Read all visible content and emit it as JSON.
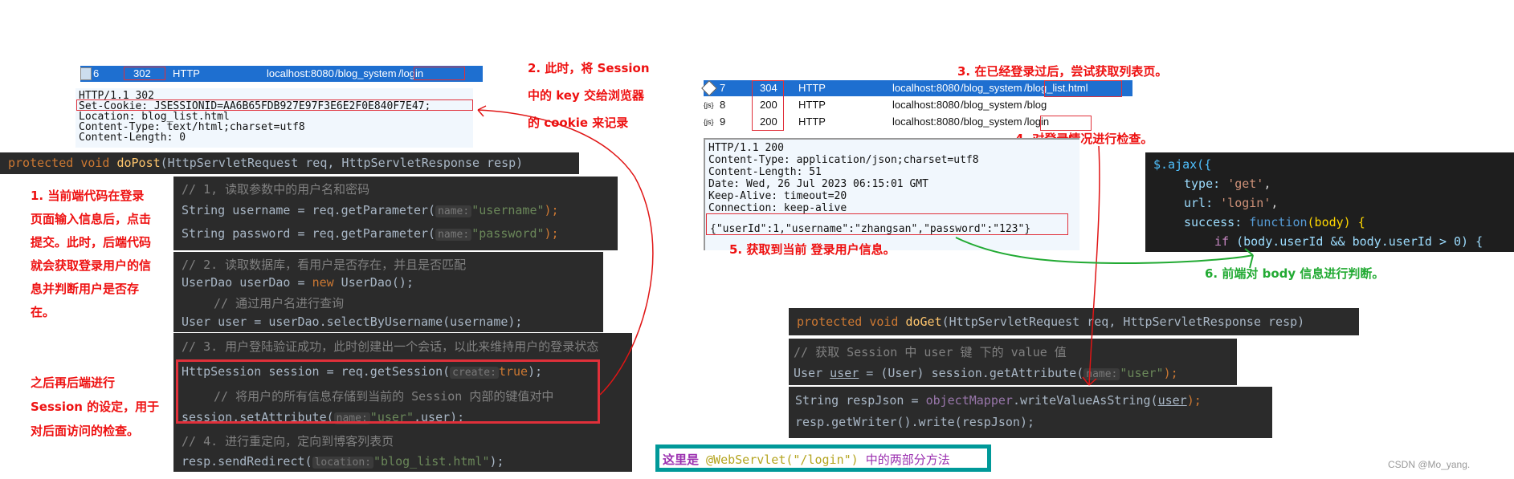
{
  "left_network": {
    "row": {
      "id": "6",
      "status": "302",
      "proto": "HTTP",
      "host": "localhost:8080",
      "path_prefix": "/blog_system",
      "path": "/login"
    }
  },
  "left_response": {
    "lines": [
      "HTTP/1.1 302",
      "Set-Cookie: JSESSIONID=AA6B65FDB927E97F3E6E2F0E840F7E47;",
      "Location: blog_list.html",
      "Content-Type: text/html;charset=utf8",
      "Content-Length: 0"
    ]
  },
  "right_network": {
    "rows": [
      {
        "id": "7",
        "status": "304",
        "proto": "HTTP",
        "host": "localhost:8080",
        "path_prefix": "/blog_system",
        "path": "/blog_list.html"
      },
      {
        "id": "8",
        "status": "200",
        "proto": "HTTP",
        "host": "localhost:8080",
        "path_prefix": "/blog_system",
        "path": "/blog"
      },
      {
        "id": "9",
        "status": "200",
        "proto": "HTTP",
        "host": "localhost:8080",
        "path_prefix": "/blog_system",
        "path": "/login"
      }
    ]
  },
  "right_response": {
    "lines": [
      "HTTP/1.1 200",
      "Content-Type: application/json;charset=utf8",
      "Content-Length: 51",
      "Date: Wed, 26 Jul 2023 06:15:01 GMT",
      "Keep-Alive: timeout=20",
      "Connection: keep-alive"
    ],
    "json": "{\"userId\":1,\"username\":\"zhangsan\",\"password\":\"123\"}"
  },
  "annotations": {
    "a1": [
      "1. 当前端代码在登录",
      "页面输入信息后，点击",
      "提交。此时，后端代码",
      "就会获取登录用户的信",
      "息并判断用户是否存",
      "在。"
    ],
    "a1b": [
      "之后再后端进行",
      "Session 的设定，用于",
      "对后面访问的检查。"
    ],
    "a2": [
      "2. 此时，将 Session",
      "中的 key 交给浏览器",
      "的 cookie 来记录"
    ],
    "a3": "3. 在已经登录过后，尝试获取列表页。",
    "a4": "4. 对登录情况进行检查。",
    "a5": "5. 获取到当前 登录用户信息。",
    "a6": "6. 前端对 body 信息进行判断。"
  },
  "dopost": {
    "sig": {
      "kw1": "protected",
      "kw2": "void",
      "name": "doPost",
      "params": "(HttpServletRequest req, HttpServletResponse resp)"
    },
    "c1": "// 1, 读取参数中的用户名和密码",
    "l1": {
      "pre": "String username = req.getParameter(",
      "hint": "name:",
      "str": "\"username\"",
      "post": ");"
    },
    "l2": {
      "pre": "String password = req.getParameter(",
      "hint": "name:",
      "str": "\"password\"",
      "post": ");"
    },
    "c2": "// 2. 读取数据库，看用户是否存在，并且是否匹配",
    "l3": {
      "pre": "UserDao userDao = ",
      "kw": "new",
      "post": " UserDao();"
    },
    "c3": "// 通过用户名进行查询",
    "l4": "User user = userDao.selectByUsername(username);",
    "c4": "// 3. 用户登陆验证成功，此时创建出一个会话，以此来维持用户的登录状态",
    "l5": {
      "pre": "HttpSession session = req.getSession(",
      "hint": "create:",
      "kw": "true",
      "post": ");"
    },
    "c5": "// 将用户的所有信息存储到当前的 Session 内部的键值对中",
    "l6": {
      "pre": "session.setAttribute(",
      "hint": "name:",
      "str": "\"user\"",
      "post": ",user);"
    },
    "c6": "// 4. 进行重定向，定向到博客列表页",
    "l7": {
      "pre": "resp.sendRedirect(",
      "hint": "location:",
      "str": "\"blog_list.html\"",
      "post": ");"
    }
  },
  "doget": {
    "sig": {
      "kw1": "protected",
      "kw2": "void",
      "name": "doGet",
      "params": "(HttpServletRequest req, HttpServletResponse resp)"
    },
    "c1": "// 获取 Session 中 user 键 下的 value 值",
    "l1": {
      "a": "User ",
      "b": "user",
      "c": " = (User) session.getAttribute(",
      "hint": "name:",
      "str": "\"user\"",
      "post": ");"
    },
    "l2": {
      "a": "String respJson = ",
      "b": "objectMapper",
      "c": ".writeValueAsString(",
      "d": "user",
      "post": ");"
    },
    "l3": "resp.getWriter().write(respJson);"
  },
  "ajax": {
    "l1": "$.ajax({",
    "l2k": "type: ",
    "l2v": "'get'",
    "l3k": "url: ",
    "l3v": "'login'",
    "l4k": "success: ",
    "l4f": "function",
    "l4p": "(body) {",
    "l5k": "if ",
    "l5v": "(body.userId && body.userId > 0) {"
  },
  "footer_note": {
    "prefix": "这里是 ",
    "annotation": "@WebServlet(\"/login\")",
    "suffix": " 中的两部分方法"
  },
  "watermark": "CSDN @Mo_yang.",
  "colors": {
    "annotation_red": "#ee1111",
    "annotation_green": "#22aa33",
    "selected_row": "#1e6fd0",
    "note_border": "#009999"
  }
}
